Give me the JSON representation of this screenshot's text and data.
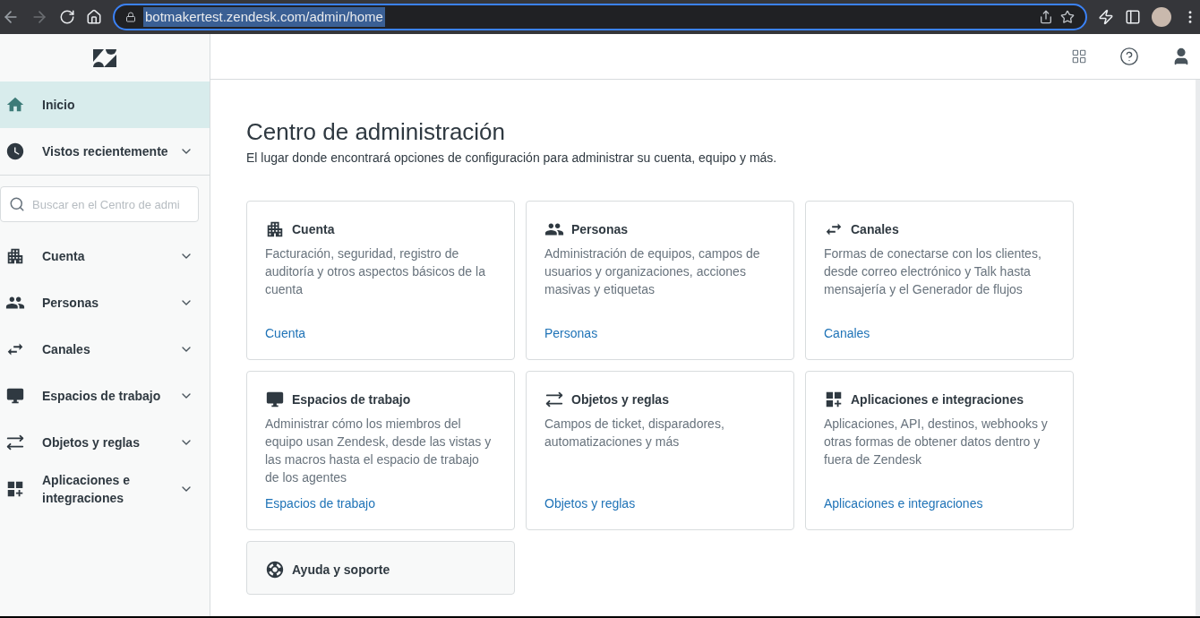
{
  "browser": {
    "url": "botmakertest.zendesk.com/admin/home",
    "url_selected": true,
    "forward_disabled": true
  },
  "sidebar": {
    "items": [
      {
        "label": "Inicio",
        "selected": true,
        "expandable": false
      },
      {
        "label": "Vistos recientemente",
        "selected": false,
        "expandable": true,
        "expanded": false
      }
    ],
    "search": {
      "placeholder": "Buscar en el Centro de admi"
    },
    "sections": [
      {
        "label": "Cuenta",
        "selected": false,
        "expanded": false
      },
      {
        "label": "Personas",
        "selected": false,
        "expanded": false
      },
      {
        "label": "Canales",
        "selected": false,
        "expanded": false
      },
      {
        "label": "Espacios de trabajo",
        "selected": false,
        "expanded": false
      },
      {
        "label": "Objetos y reglas",
        "selected": false,
        "expanded": false
      },
      {
        "label": "Aplicaciones e integraciones",
        "selected": false,
        "expanded": false
      }
    ]
  },
  "page": {
    "title": "Centro de administración",
    "subtitle": "El lugar donde encontrará opciones de configuración para administrar su cuenta, equipo y más."
  },
  "cards": [
    {
      "title": "Cuenta",
      "description": "Facturación, seguridad, registro de auditoría y otros aspectos básicos de la cuenta",
      "link": "Cuenta",
      "kind": "normal"
    },
    {
      "title": "Personas",
      "description": "Administración de equipos, campos de usuarios y organizaciones, acciones masivas y etiquetas",
      "link": "Personas",
      "kind": "normal"
    },
    {
      "title": "Canales",
      "description": "Formas de conectarse con los clientes, desde correo electrónico y Talk hasta mensajería y el Generador de flujos",
      "link": "Canales",
      "kind": "normal"
    },
    {
      "title": "Espacios de trabajo",
      "description": "Administrar cómo los miembros del equipo usan Zendesk, desde las vistas y las macros hasta el espacio de trabajo de los agentes",
      "link": "Espacios de trabajo",
      "kind": "normal"
    },
    {
      "title": "Objetos y reglas",
      "description": "Campos de ticket, disparadores, automatizaciones y más",
      "link": "Objetos y reglas",
      "kind": "normal"
    },
    {
      "title": "Aplicaciones e integraciones",
      "description": "Aplicaciones, API, destinos, webhooks y otras formas de obtener datos dentro y fuera de Zendesk",
      "link": "Aplicaciones e integraciones",
      "kind": "normal"
    },
    {
      "title": "Ayuda y soporte",
      "kind": "support"
    }
  ]
}
